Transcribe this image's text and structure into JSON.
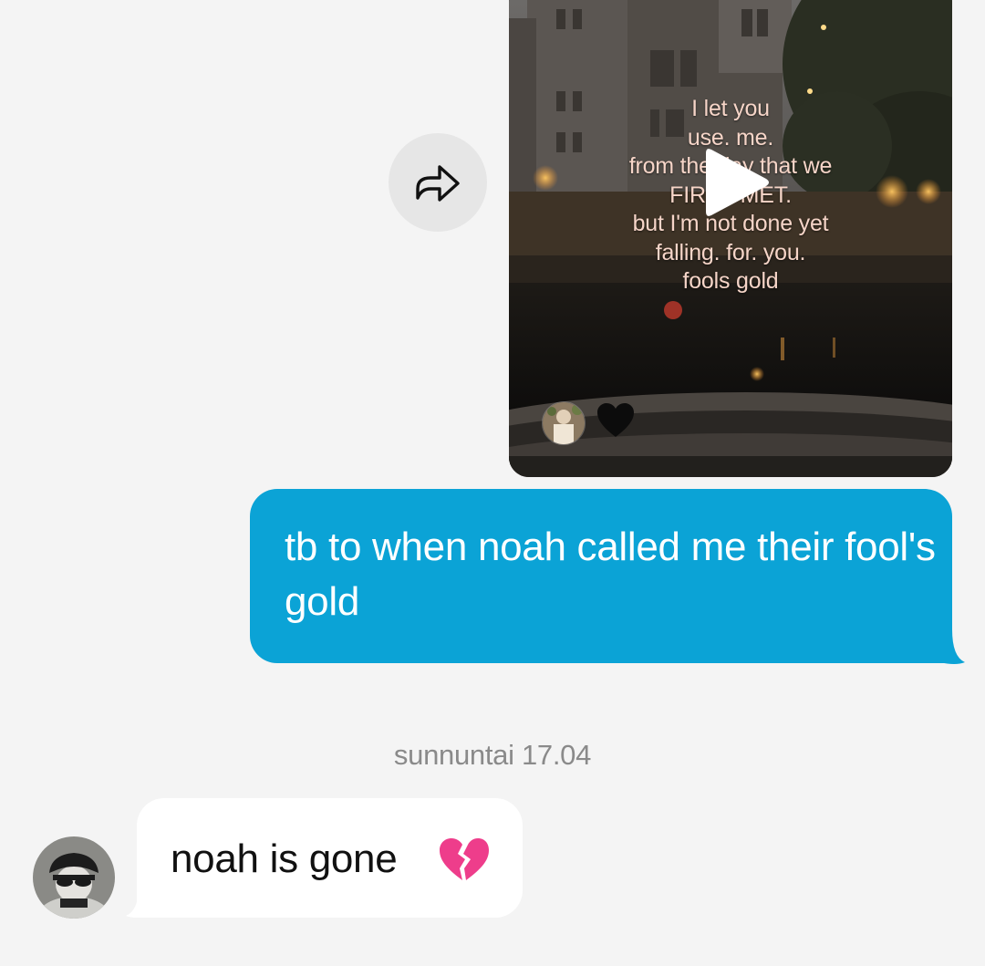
{
  "video_post": {
    "overlay_lines": [
      "I let you",
      "use. me.",
      "from the day that we",
      "FIRST MET.",
      "but I'm not done yet",
      "falling. for. you.",
      "fools gold"
    ],
    "reaction": "black-heart-icon",
    "play_icon": "play-icon"
  },
  "forward": {
    "icon": "share-arrow-icon"
  },
  "messages": {
    "outgoing": {
      "text": "tb to when noah called me their fool's gold",
      "color": "#0ba3d6"
    },
    "date_separator": "sunnuntai 17.04",
    "incoming": {
      "text": "noah is gone",
      "emoji": "broken-heart-icon",
      "color": "#ffffff"
    }
  }
}
